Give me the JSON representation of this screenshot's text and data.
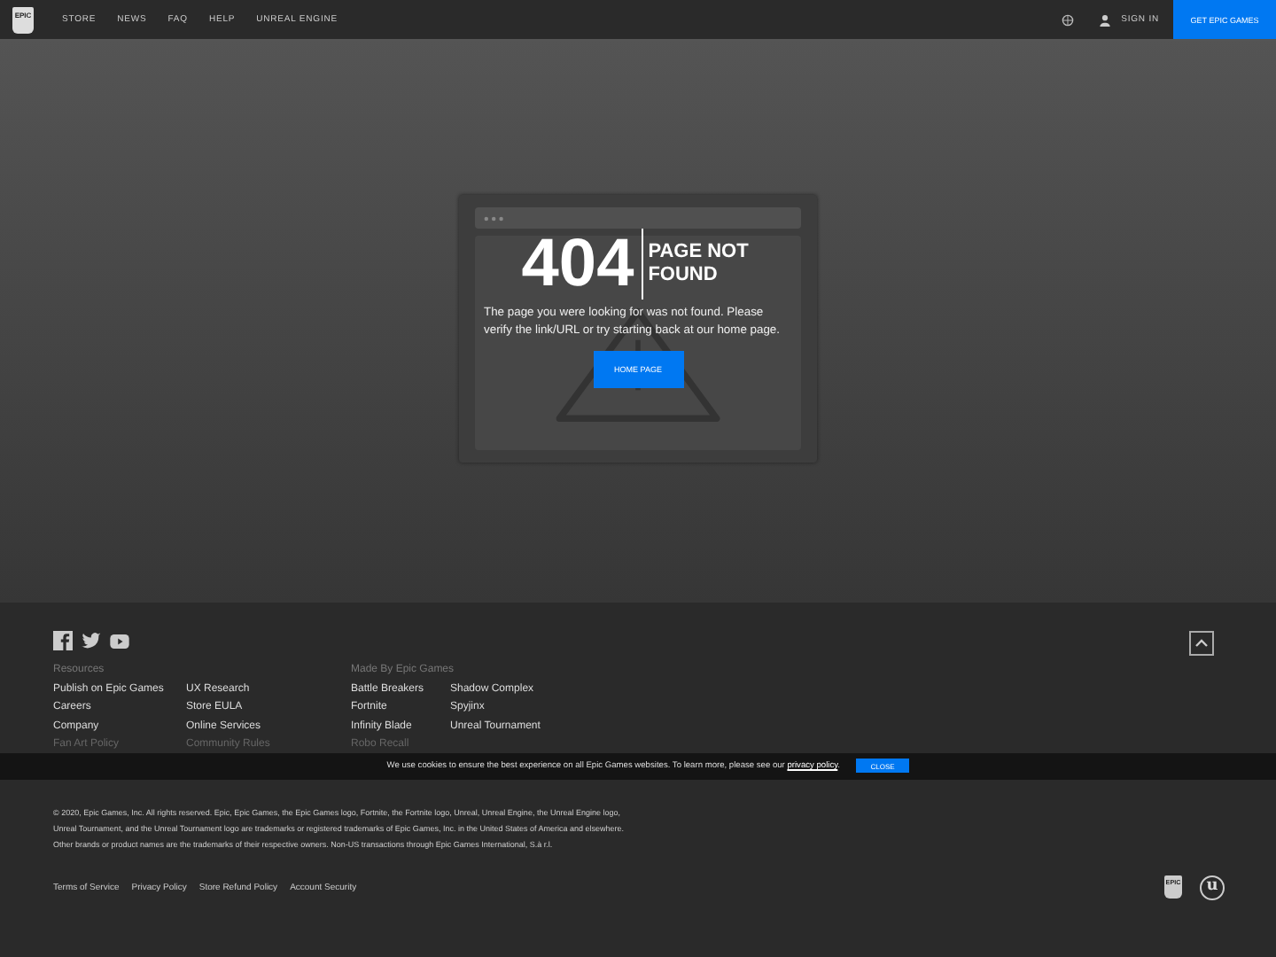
{
  "header": {
    "logo_text": "EPIC",
    "nav": [
      "STORE",
      "NEWS",
      "FAQ",
      "HELP",
      "UNREAL ENGINE"
    ],
    "sign_in": "SIGN IN",
    "cta": "GET EPIC GAMES"
  },
  "error": {
    "code": "404",
    "title": "PAGE NOT FOUND",
    "message": "The page you were looking for was not found. Please verify the link/URL or try starting back at our home page.",
    "button": "HOME PAGE"
  },
  "footer": {
    "sections": [
      {
        "heading": "Resources",
        "columns": [
          [
            "Publish on Epic Games",
            "Careers",
            "Company",
            "Fan Art Policy"
          ],
          [
            "UX Research",
            "Store EULA",
            "Online Services",
            "Community Rules"
          ]
        ]
      },
      {
        "heading": "Made By Epic Games",
        "columns": [
          [
            "Battle Breakers",
            "Fortnite",
            "Infinity Blade",
            "Robo Recall"
          ],
          [
            "Shadow Complex",
            "Spyjinx",
            "Unreal Tournament"
          ]
        ]
      }
    ],
    "cookie": {
      "text": "We use cookies to ensure the best experience on all Epic Games websites. To learn more, please see our",
      "link": "privacy policy",
      "end": ".",
      "button": "CLOSE"
    },
    "legal": "© 2020, Epic Games, Inc. All rights reserved. Epic, Epic Games, the Epic Games logo, Fortnite, the Fortnite logo, Unreal, Unreal Engine, the Unreal Engine logo, Unreal Tournament, and the Unreal Tournament logo are trademarks or registered trademarks of Epic Games, Inc. in the United States of America and elsewhere. Other brands or product names are the trademarks of their respective owners. Non-US transactions through Epic Games International, S.à r.l.",
    "links": [
      "Terms of Service",
      "Privacy Policy",
      "Store Refund Policy",
      "Account Security"
    ],
    "logo_text": "EPIC",
    "unreal_text": "u"
  }
}
